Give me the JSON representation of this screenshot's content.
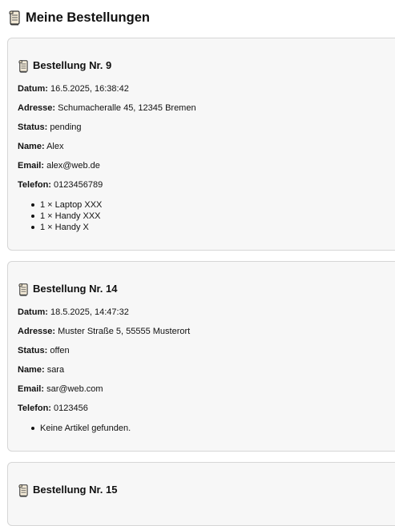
{
  "page": {
    "title": "Meine Bestellungen"
  },
  "labels": {
    "date": "Datum:",
    "address": "Adresse:",
    "status": "Status:",
    "name": "Name:",
    "email": "Email:",
    "phone": "Telefon:"
  },
  "orders": [
    {
      "heading": "Bestellung Nr. 9",
      "date": "16.5.2025, 16:38:42",
      "address": "Schumacheralle 45, 12345 Bremen",
      "status": "pending",
      "name": "Alex",
      "email": "alex@web.de",
      "phone": "0123456789",
      "items": [
        "1 × Laptop XXX",
        "1 × Handy XXX",
        "1 × Handy X"
      ]
    },
    {
      "heading": "Bestellung Nr. 14",
      "date": "18.5.2025, 14:47:32",
      "address": "Muster Straße 5, 55555 Musterort",
      "status": "offen",
      "name": "sara",
      "email": "sar@web.com",
      "phone": "0123456",
      "items": [
        "Keine Artikel gefunden."
      ]
    },
    {
      "heading": "Bestellung Nr. 15"
    }
  ],
  "icons": {
    "title": "scroll-icon",
    "order": "scroll-icon"
  }
}
